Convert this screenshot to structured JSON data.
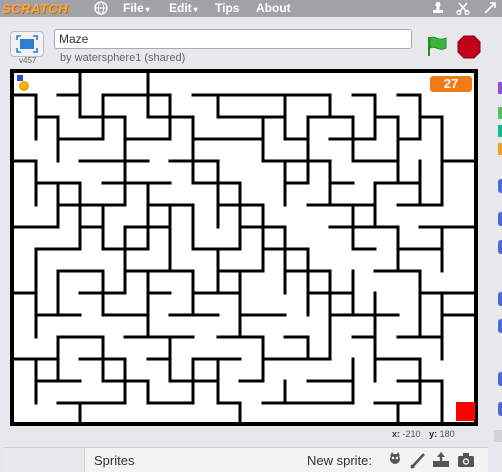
{
  "menubar": {
    "logo": "SCRATCH",
    "items": [
      "File",
      "Edit",
      "Tips",
      "About"
    ],
    "dropdown_arrow": "▾"
  },
  "project": {
    "title": "Maze",
    "byline": "by watersphere1 (shared)",
    "version": "v457"
  },
  "stage": {
    "timer_value": "27",
    "wall_color": "#000000",
    "goal_color": "#ff0000",
    "player_colors": [
      "#1e4ed8",
      "#f5b400"
    ]
  },
  "coords": {
    "x_label": "x:",
    "x_value": "-210",
    "y_label": "y:",
    "y_value": "180"
  },
  "sprites_bar": {
    "sprites_label": "Sprites",
    "new_sprite_label": "New sprite:",
    "icons": [
      "sprite-library-icon",
      "paint-brush-icon",
      "upload-sprite-icon",
      "camera-icon"
    ]
  },
  "colors": {
    "menubar_bg": "#9fa3a8",
    "logo": "#f9a640",
    "timer_bg": "#ee7d16",
    "flag": "#3cb43c",
    "stop": "#c2001b"
  }
}
